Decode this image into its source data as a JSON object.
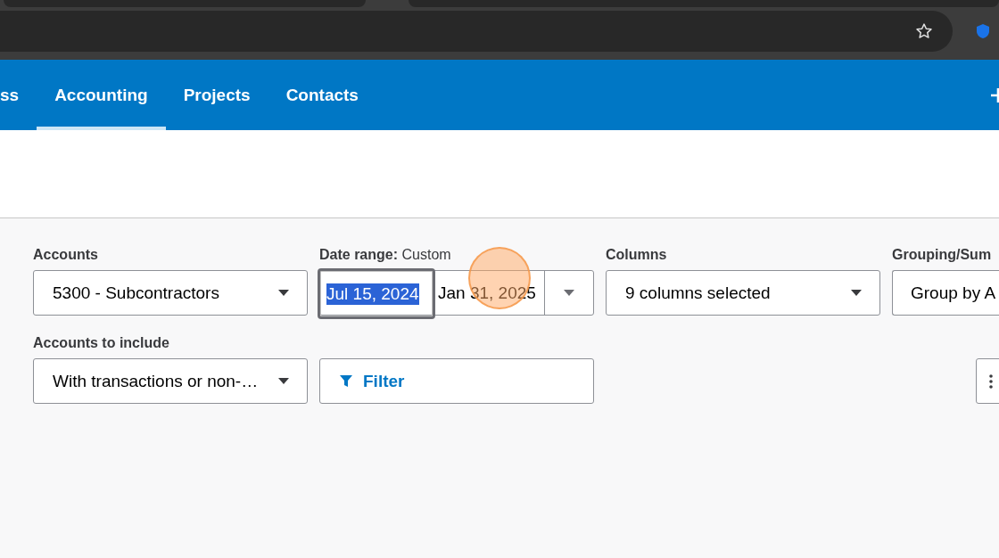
{
  "nav": {
    "tabs": [
      {
        "label": "ss",
        "selected": false
      },
      {
        "label": "Accounting",
        "selected": true
      },
      {
        "label": "Projects",
        "selected": false
      },
      {
        "label": "Contacts",
        "selected": false
      }
    ]
  },
  "filters": [
    {
      "kind": "select",
      "label": "Accounts",
      "value": "5300 - Subcontractors"
    },
    {
      "kind": "daterange",
      "label": "**Date range:** Custom",
      "start": "Jul 15, 2024",
      "start_highlighted": true,
      "end": "Jan 31, 2025"
    },
    {
      "kind": "select",
      "label": "Columns",
      "value": "9 columns selected"
    },
    {
      "kind": "select",
      "label": "Grouping/Sum",
      "value": "Group by A"
    },
    {
      "kind": "select",
      "label": "Accounts to include",
      "value": "With transactions or non-…"
    },
    {
      "kind": "filter",
      "value": "Filter"
    },
    {
      "kind": "spacer"
    },
    {
      "kind": "more"
    }
  ]
}
